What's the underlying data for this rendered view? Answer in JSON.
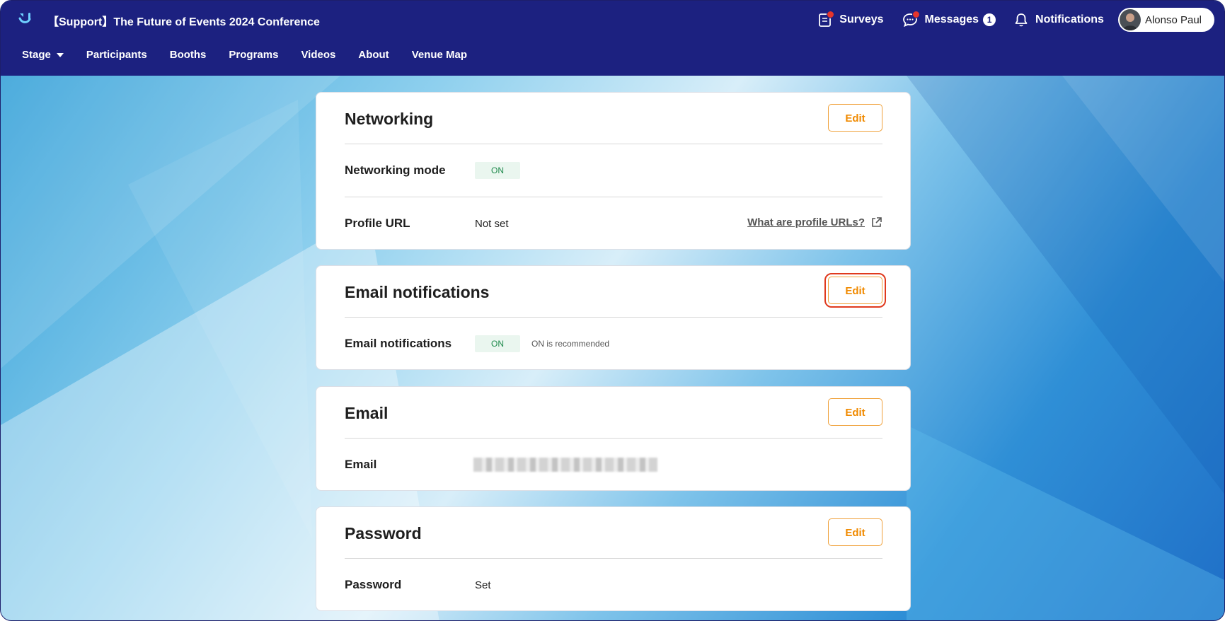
{
  "header": {
    "event_title": "【Support】The Future of Events 2024 Conference",
    "surveys_label": "Surveys",
    "messages_label": "Messages",
    "messages_count": "1",
    "notifications_label": "Notifications",
    "user_name": "Alonso Paul"
  },
  "nav": {
    "items": [
      "Stage",
      "Participants",
      "Booths",
      "Programs",
      "Videos",
      "About",
      "Venue Map"
    ]
  },
  "cards": {
    "networking": {
      "title": "Networking",
      "edit_label": "Edit",
      "mode_label": "Networking mode",
      "mode_value": "ON",
      "profile_url_label": "Profile URL",
      "profile_url_value": "Not set",
      "profile_url_help": "What are profile URLs?"
    },
    "email_notifications": {
      "title": "Email notifications",
      "edit_label": "Edit",
      "row_label": "Email notifications",
      "row_value": "ON",
      "hint": "ON is recommended"
    },
    "email": {
      "title": "Email",
      "edit_label": "Edit",
      "row_label": "Email"
    },
    "password": {
      "title": "Password",
      "edit_label": "Edit",
      "row_label": "Password",
      "row_value": "Set"
    }
  },
  "colors": {
    "header_bg": "#1c2180",
    "accent_orange": "#f08a00",
    "on_green": "#1f8a4c",
    "highlight_red": "#e03a1e"
  },
  "icons": {
    "logo": "app-logo-icon",
    "surveys": "clipboard-icon",
    "messages": "chat-bubble-icon",
    "notifications": "bell-icon",
    "external": "external-link-icon",
    "dropdown": "caret-down-icon"
  }
}
